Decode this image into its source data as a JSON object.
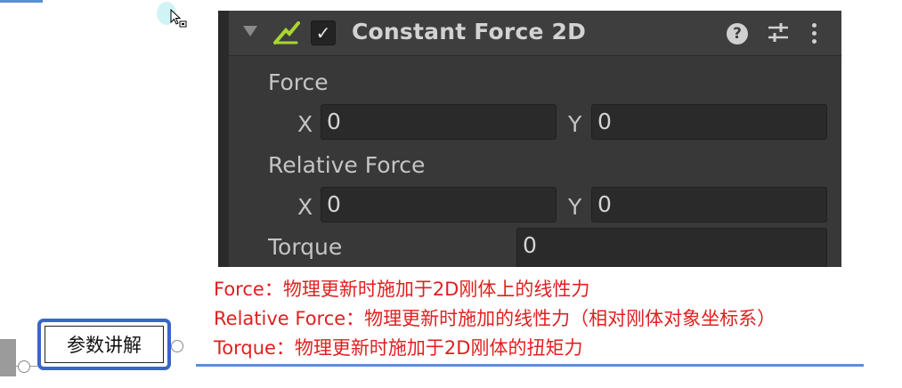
{
  "component": {
    "title": "Constant Force 2D",
    "enabled_mark": "✓",
    "help_glyph": "?",
    "icons": [
      "fold-arrow-icon",
      "constant-force-2d-icon",
      "enabled-checkbox",
      "help-icon",
      "preset-icon",
      "kebab-menu-icon"
    ]
  },
  "properties": {
    "force": {
      "label": "Force",
      "x_label": "X",
      "x_value": "0",
      "y_label": "Y",
      "y_value": "0"
    },
    "relative_force": {
      "label": "Relative Force",
      "x_label": "X",
      "x_value": "0",
      "y_label": "Y",
      "y_value": "0"
    },
    "torque": {
      "label": "Torque",
      "value": "0"
    }
  },
  "notes": {
    "line1": "Force：物理更新时施加于2D刚体上的线性力",
    "line2": "Relative Force：物理更新时施加的线性力（相对刚体对象坐标系）",
    "line3": "Torque：物理更新时施加于2D刚体的扭矩力"
  },
  "mindmap": {
    "node_label": "参数讲解"
  },
  "colors": {
    "panel_bg": "#383838",
    "field_bg": "#2a2a2a",
    "note_red": "#e0201f",
    "node_border": "#3a66c8",
    "accent_line": "#5b8fd4",
    "icon_green": "#a8d630"
  }
}
